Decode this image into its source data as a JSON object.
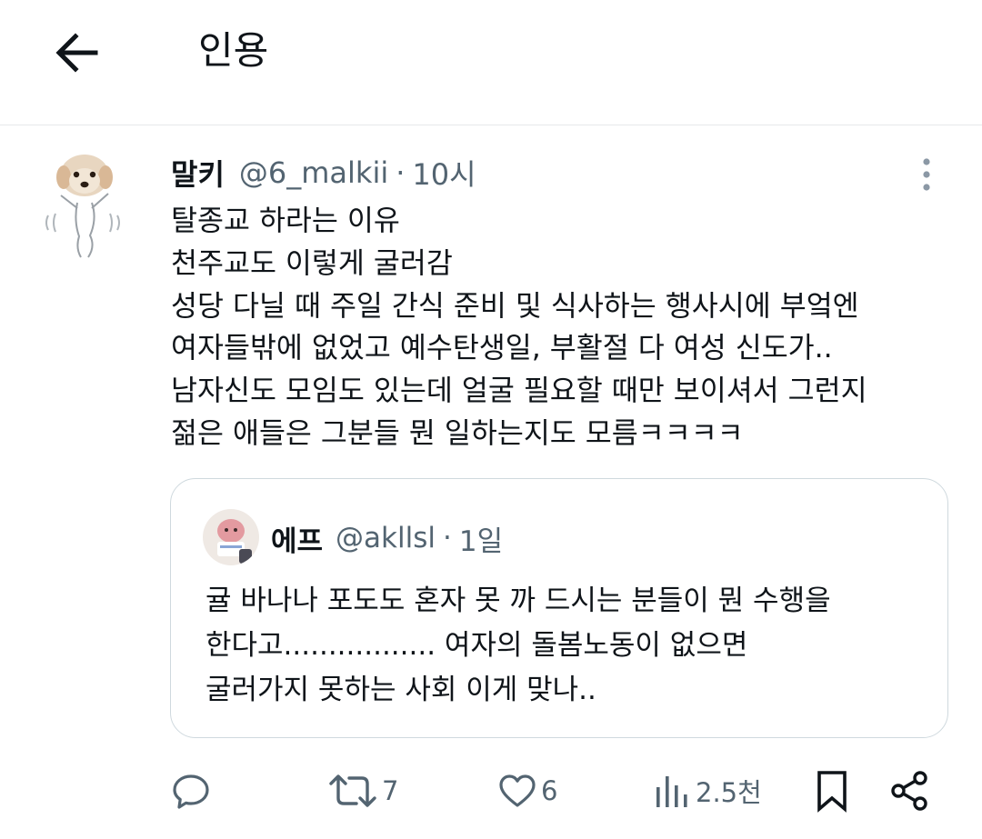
{
  "header": {
    "title": "인용"
  },
  "post": {
    "author_name": "말키",
    "author_handle": "@6_malkii",
    "separator": "·",
    "time": "10시",
    "lines": [
      "탈종교 하라는 이유",
      "천주교도 이렇게 굴러감",
      "성당 다닐 때 주일 간식 준비 및 식사하는 행사시에 부엌엔",
      "여자들밖에 없었고 예수탄생일, 부활절 다 여성 신도가..",
      "남자신도 모임도 있는데 얼굴 필요할 때만 보이셔서 그런지",
      "젊은 애들은 그분들 뭔 일하는지도 모름ㅋㅋㅋㅋ"
    ]
  },
  "quote": {
    "author_name": "에프",
    "author_handle": "@akllsl",
    "separator": "·",
    "time": "1일",
    "lines": [
      "귤 바나나 포도도 혼자 못 까 드시는 분들이 뭔 수행을",
      "한다고................. 여자의 돌봄노동이 없으면",
      "굴러가지 못하는 사회 이게 맞나.."
    ]
  },
  "actions": {
    "reply_icon": "reply-icon",
    "retweet_count": "7",
    "like_count": "6",
    "views_count": "2.5천",
    "bookmark_icon": "bookmark-icon",
    "share_icon": "share-icon"
  },
  "colors": {
    "text_primary": "#0f1419",
    "text_secondary": "#536471",
    "border": "#cfd9de",
    "divider": "#e6e9eb"
  }
}
